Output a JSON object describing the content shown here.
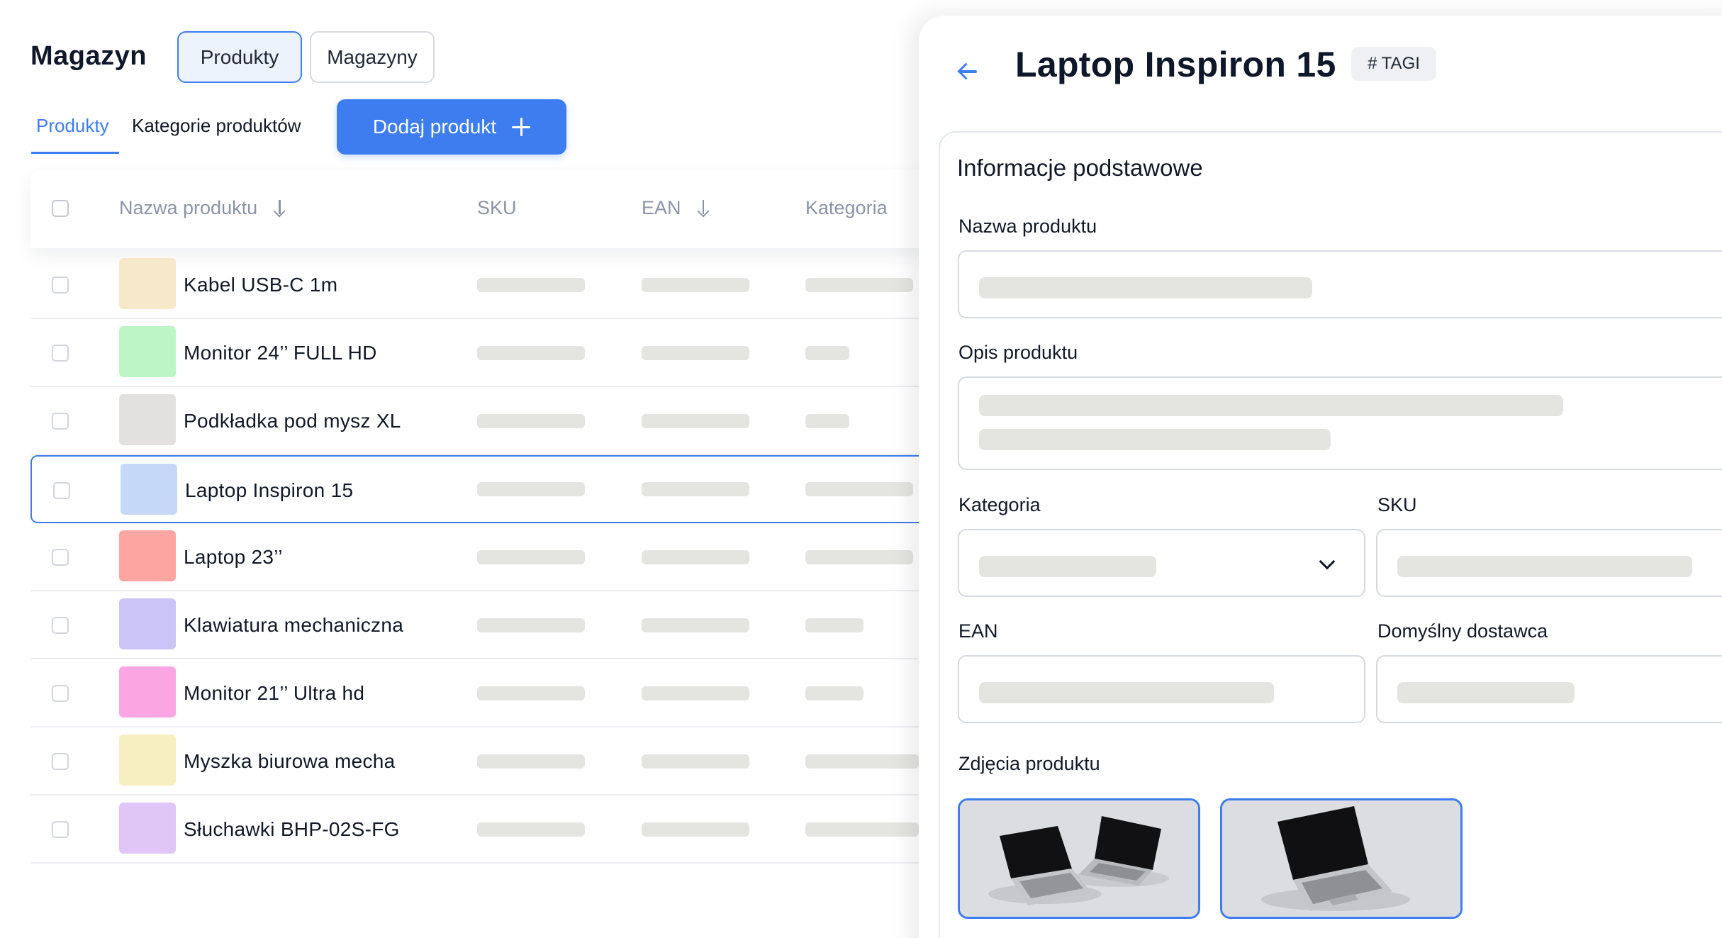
{
  "header": {
    "title": "Magazyn"
  },
  "segment": {
    "products": "Produkty",
    "warehouses": "Magazyny"
  },
  "subtabs": {
    "products": "Produkty",
    "categories": "Kategorie produktów"
  },
  "add_button": {
    "label": "Dodaj produkt",
    "icon": "plus-icon"
  },
  "table": {
    "columns": {
      "name": "Nazwa produktu",
      "sku": "SKU",
      "ean": "EAN",
      "category": "Kategoria"
    },
    "sort_icon": "arrow-down-icon",
    "rows": [
      {
        "name": "Kabel USB-C 1m",
        "color": "#f6e8c8"
      },
      {
        "name": "Monitor 24’’ FULL HD",
        "color": "#bdf5c6"
      },
      {
        "name": "Podkładka pod mysz XL",
        "color": "#e2e1df"
      },
      {
        "name": "Laptop Inspiron 15",
        "color": "#c6d8f8",
        "selected": true
      },
      {
        "name": "Laptop 23’’",
        "color": "#fca5a1"
      },
      {
        "name": "Klawiatura mechaniczna",
        "color": "#cbc4f6"
      },
      {
        "name": "Monitor 21’’ Ultra hd",
        "color": "#fba6e2"
      },
      {
        "name": "Myszka biurowa mecha",
        "color": "#f7eec2"
      },
      {
        "name": "Słuchawki BHP-02S-FG",
        "color": "#dfc6f6"
      }
    ]
  },
  "detail": {
    "back_icon": "arrow-left-icon",
    "title": "Laptop Inspiron 15",
    "tag_chip": "# TAGI",
    "section_title": "Informacje podstawowe",
    "labels": {
      "name": "Nazwa produktu",
      "description": "Opis produktu",
      "category": "Kategoria",
      "sku": "SKU",
      "ean": "EAN",
      "supplier": "Domyślny dostawca",
      "photos": "Zdjęcia produktu"
    },
    "category_dropdown_icon": "chevron-down-icon"
  },
  "colors": {
    "accent": "#3d7df0",
    "accent_light": "#edf3fd",
    "skeleton": "#e4e4e1",
    "text": "#111827",
    "muted": "#8a94a6"
  }
}
